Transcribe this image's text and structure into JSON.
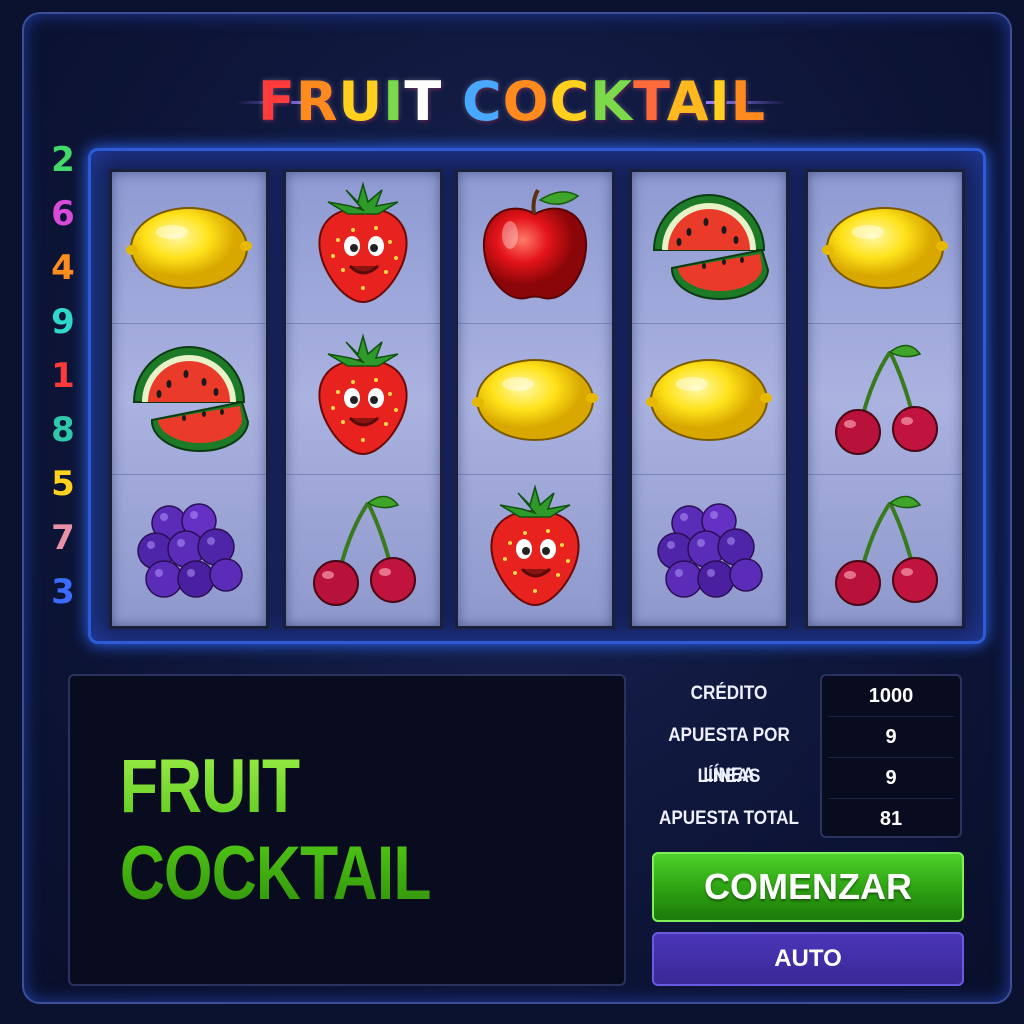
{
  "game": {
    "title": "FRUIT COCKTAIL",
    "title_color": "#ffffff",
    "title_letter_colors": [
      "#ff3b3b",
      "#ff8a1e",
      "#ffd11e",
      "#7bd94a",
      "#ffffff",
      "#49a8ff",
      "#ff8a1e",
      "#ffd11e",
      "#7bd94a",
      "#ff6a3b",
      "#ffb81e",
      "#ffd11e",
      "#ff8a1e",
      "#ff7a1e"
    ],
    "message": "FRUIT COCKTAIL"
  },
  "paylines": [
    {
      "label": "2",
      "color": "#42d86a"
    },
    {
      "label": "6",
      "color": "#d84ad8"
    },
    {
      "label": "4",
      "color": "#ff8c1e"
    },
    {
      "label": "9",
      "color": "#2fd8ca"
    },
    {
      "label": "1",
      "color": "#ff3a3a"
    },
    {
      "label": "8",
      "color": "#2fc8a8"
    },
    {
      "label": "5",
      "color": "#ffd21e"
    },
    {
      "label": "7",
      "color": "#e890a8"
    },
    {
      "label": "3",
      "color": "#3a6cff"
    }
  ],
  "reels": [
    [
      "lemon",
      "watermelon",
      "grapes"
    ],
    [
      "strawberry",
      "strawberry",
      "cherries"
    ],
    [
      "apple",
      "lemon",
      "strawberry"
    ],
    [
      "watermelon",
      "lemon",
      "grapes"
    ],
    [
      "lemon",
      "cherries",
      "cherries"
    ]
  ],
  "stats": {
    "credit_label": "CRÉDITO",
    "credit_value": "1000",
    "bet_per_line_label": "APUESTA POR LÍNEA",
    "bet_per_line_value": "9",
    "lines_label": "LÍNEAS",
    "lines_value": "9",
    "total_bet_label": "APUESTA TOTAL",
    "total_bet_value": "81"
  },
  "buttons": {
    "start_label": "COMENZAR",
    "auto_label": "AUTO"
  }
}
